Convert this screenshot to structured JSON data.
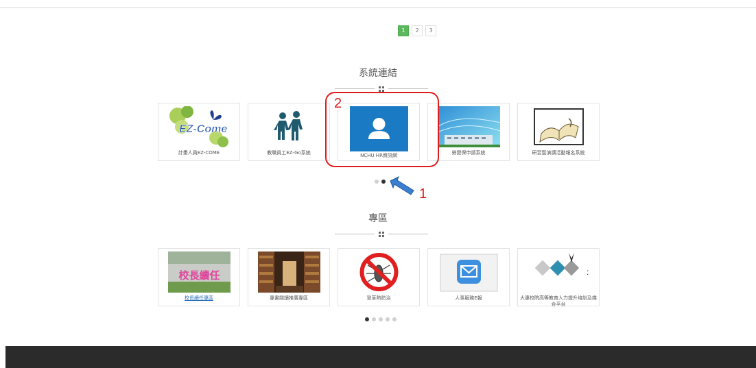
{
  "pagination": {
    "pages": [
      "1",
      "2",
      "3"
    ],
    "active": "1"
  },
  "system_links": {
    "title": "系統連結",
    "cards": [
      {
        "caption": "計畫人員EZ-COME",
        "logo_text": "EZ-Come"
      },
      {
        "caption": "教職員工EZ-Go系統"
      },
      {
        "caption": "NCHU HR資訊網"
      },
      {
        "caption": "勞健保申請系統"
      },
      {
        "caption": "研習暨演講活動報名系統"
      }
    ],
    "carousel_dots": 2,
    "active_dot": 1
  },
  "zone": {
    "title": "專區",
    "cards": [
      {
        "caption": "校長續任專區",
        "banner_text": "校長續任"
      },
      {
        "caption": "專書閱讀推廣專區"
      },
      {
        "caption": "登革熱防治"
      },
      {
        "caption": "人事服務E報"
      },
      {
        "caption": "大專校院高等教育人力提升培訓及媒合平台",
        "side_text": ":"
      }
    ],
    "carousel_dots": 5,
    "active_dot": 0
  },
  "annotations": {
    "arrow_label": "1",
    "box_label": "2"
  },
  "colors": {
    "accent": "#5cb85c",
    "annotation": "#e01b1b",
    "footer": "#2b2b2b",
    "hr_tile": "#1a7bc4"
  }
}
